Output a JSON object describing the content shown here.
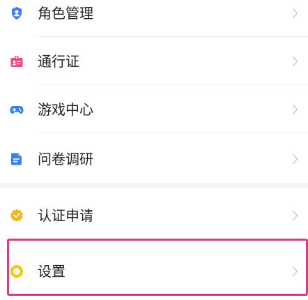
{
  "menu": {
    "items": [
      {
        "label": "角色管理",
        "icon": "user-shield-icon",
        "color": "#3d7ef5"
      },
      {
        "label": "通行证",
        "icon": "badge-card-icon",
        "color": "#f04a78"
      },
      {
        "label": "游戏中心",
        "icon": "gamepad-icon",
        "color": "#3d7ef5"
      },
      {
        "label": "问卷调研",
        "icon": "document-icon",
        "color": "#3d7ef5"
      },
      {
        "label": "认证申请",
        "icon": "verified-shield-icon",
        "color": "#f5b21a"
      },
      {
        "label": "设置",
        "icon": "settings-ring-icon",
        "color": "#f5c518"
      }
    ],
    "chevron_icon": "chevron-right-icon",
    "chevron_color": "#c8c8c8",
    "highlight_color": "#d63b8f",
    "highlighted_item": "设置"
  }
}
